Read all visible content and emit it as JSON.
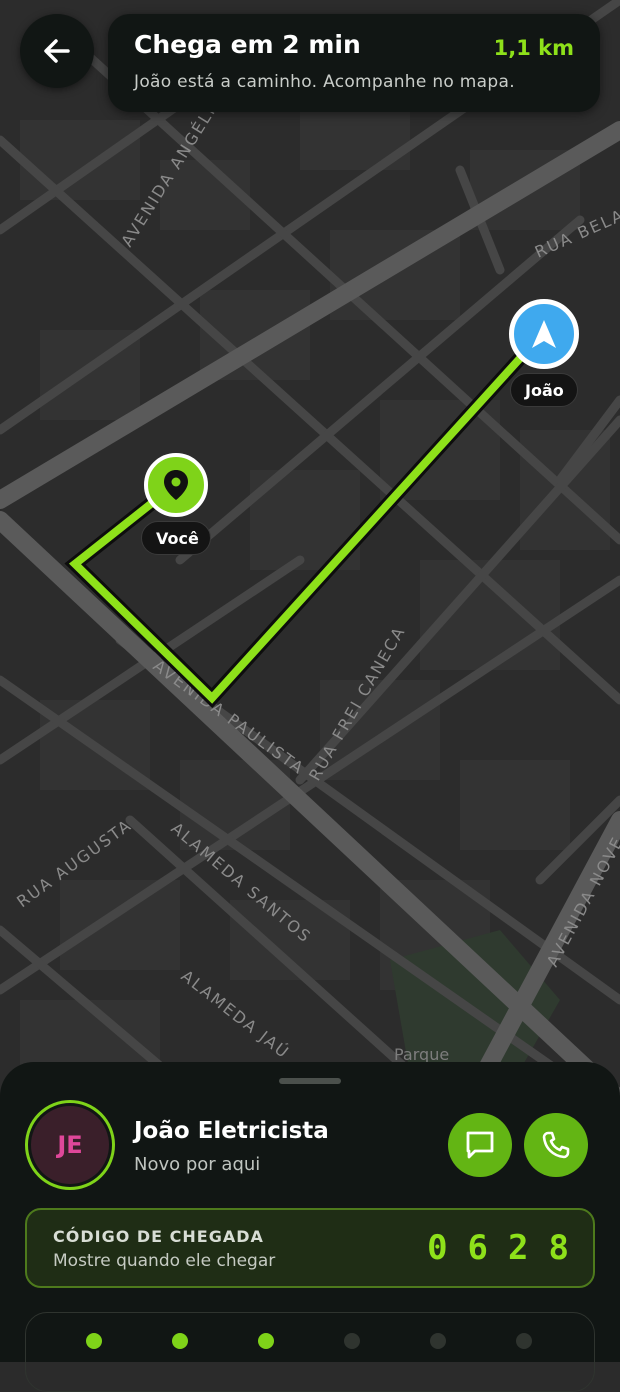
{
  "header": {
    "eta_title": "Chega em 2 min",
    "distance": "1,1 km",
    "subtitle": "João está a caminho. Acompanhe no mapa."
  },
  "map": {
    "streets": [
      "AVENIDA ANGÉLICA",
      "RUA BELA",
      "AVENIDA PAULISTA",
      "RUA FREI CANECA",
      "RUA AUGUSTA",
      "ALAMEDA SANTOS",
      "ALAMEDA JAÚ",
      "AVENIDA NOVE"
    ],
    "poi_label": "Parque",
    "you_label": "Você",
    "driver_label": "João",
    "route_color": "#8ee11a"
  },
  "driver": {
    "initials": "JE",
    "name": "João Eletricista",
    "status": "Novo por aqui",
    "chat_icon": "chat-bubble-icon",
    "call_icon": "phone-icon"
  },
  "arrival_code": {
    "label": "CÓDIGO DE CHEGADA",
    "hint": "Mostre quando ele chegar",
    "digits": [
      "0",
      "6",
      "2",
      "8"
    ]
  },
  "colors": {
    "accent": "#8ee11a",
    "driver_pin": "#3fa9ee",
    "sheet_bg": "#111614"
  }
}
